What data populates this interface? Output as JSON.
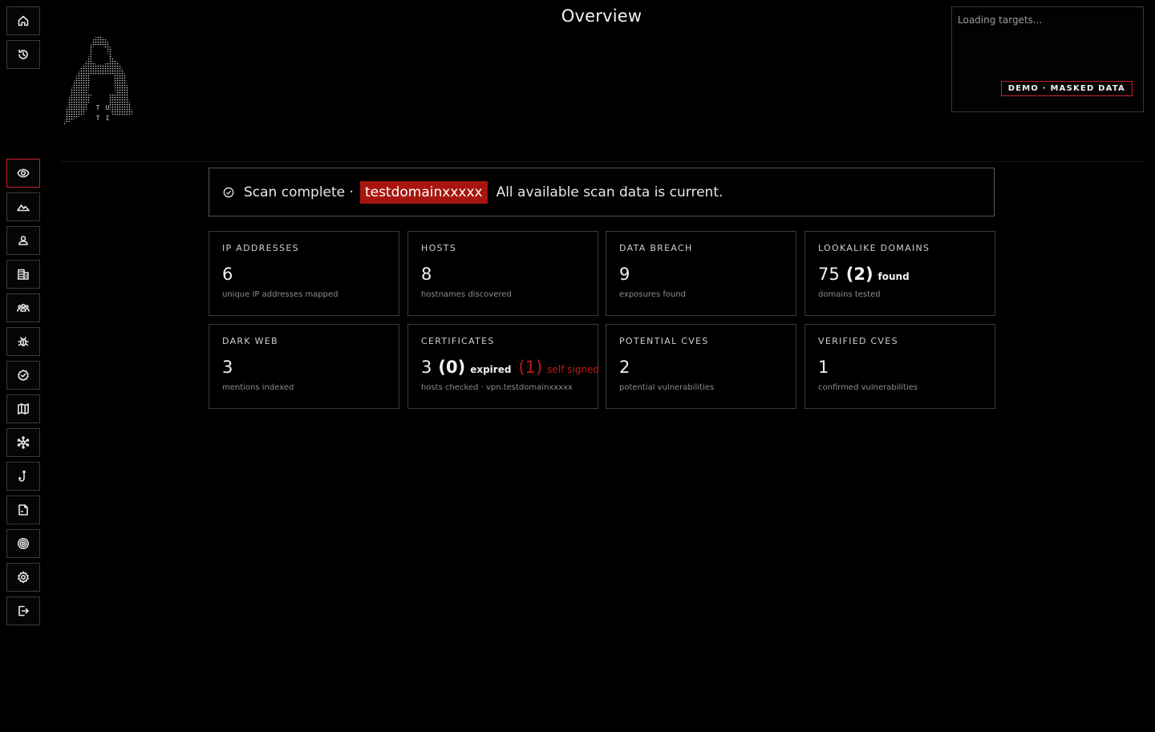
{
  "header": {
    "title": "Overview"
  },
  "target_panel": {
    "loading_text": "Loading targets...",
    "demo_badge": "DEMO · MASKED DATA"
  },
  "status": {
    "prefix": "Scan complete ·",
    "domain": "testdomainxxxxx",
    "message": "All available scan data is current."
  },
  "sidebar": {
    "top_items": [
      "home-icon",
      "history-icon"
    ],
    "items": [
      "eye-icon",
      "mountain-icon",
      "person-icon",
      "building-icon",
      "group-icon",
      "bug-icon",
      "verified-icon",
      "map-icon",
      "network-icon",
      "hook-icon",
      "document-icon",
      "target-icon",
      "settings-icon",
      "logout-icon"
    ]
  },
  "logo": {
    "letters": [
      "T",
      "U",
      "T",
      "I"
    ]
  },
  "cards": {
    "ip": {
      "label": "IP ADDRESSES",
      "value": "6",
      "sub": "unique IP addresses mapped"
    },
    "hosts": {
      "label": "HOSTS",
      "value": "8",
      "sub": "hostnames discovered"
    },
    "breach": {
      "label": "DATA BREACH",
      "value": "9",
      "sub": "exposures found"
    },
    "lookalike": {
      "label": "LOOKALIKE DOMAINS",
      "value": "75",
      "found_count": "(2)",
      "found_text": "found",
      "sub": "domains tested"
    },
    "darkweb": {
      "label": "DARK WEB",
      "value": "3",
      "sub": "mentions indexed"
    },
    "certs": {
      "label": "CERTIFICATES",
      "value": "3",
      "expired_count": "(0)",
      "expired_text": "expired",
      "self_signed_count": "(1)",
      "self_signed_text": "self signed",
      "sub": "hosts checked · vpn.testdomainxxxxx"
    },
    "potential_cves": {
      "label": "POTENTIAL CVES",
      "value": "2",
      "sub": "potential vulnerabilities"
    },
    "verified_cves": {
      "label": "VERIFIED CVES",
      "value": "1",
      "sub": "confirmed vulnerabilities"
    }
  },
  "colors": {
    "accent": "#c8202a",
    "pill": "#a8150f",
    "background": "#000000"
  }
}
